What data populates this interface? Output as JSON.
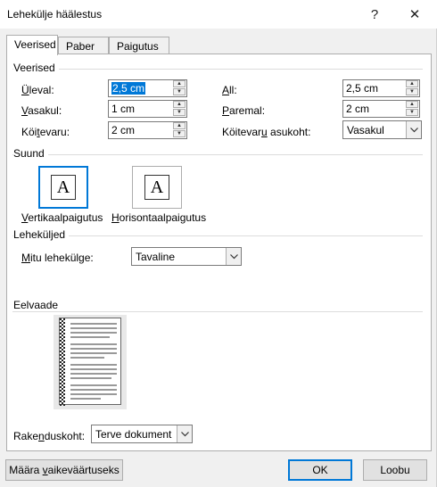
{
  "window": {
    "title": "Lehekülje häälestus",
    "help_glyph": "?",
    "close_glyph": "✕"
  },
  "tabs": [
    {
      "label": "Veerised",
      "active": true
    },
    {
      "label": "Paber",
      "active": false
    },
    {
      "label": "Paigutus",
      "active": false
    }
  ],
  "margins": {
    "group_label": "Veerised",
    "top": {
      "label_u": "Ü",
      "label_rest": "leval:",
      "value": "2,5 cm"
    },
    "bottom": {
      "label_u": "A",
      "label_rest": "ll:",
      "value": "2,5 cm"
    },
    "left": {
      "label_u": "V",
      "label_rest": "asakul:",
      "value": "1 cm"
    },
    "right": {
      "label_u": "P",
      "label_rest": "aremal:",
      "value": "2 cm"
    },
    "gutter": {
      "label_pre": "Köi",
      "label_u": "t",
      "label_rest": "evaru:",
      "value": "2 cm"
    },
    "gutter_position": {
      "label_pre": "Köitevar",
      "label_u": "u",
      "label_rest": " asukoht:",
      "value": "Vasakul"
    }
  },
  "orientation": {
    "group_label": "Suund",
    "portrait": {
      "label_u": "V",
      "label_rest": "ertikaalpaigutus",
      "selected": true
    },
    "landscape": {
      "label_u": "H",
      "label_rest": "orisontaalpaigutus",
      "selected": false
    },
    "icon_letter": "A"
  },
  "pages": {
    "group_label": "Leheküljed",
    "multiple_label_pre": "",
    "multiple_label_u": "M",
    "multiple_label_rest": "itu lehekülge:",
    "multiple_value": "Tavaline"
  },
  "preview": {
    "group_label": "Eelvaade"
  },
  "apply_to": {
    "label_pre": "Rake",
    "label_u": "n",
    "label_rest": "duskoht:",
    "value": "Terve dokument"
  },
  "buttons": {
    "default_pre": "Määra ",
    "default_u": "v",
    "default_rest": "aikeväärtuseks",
    "ok": "OK",
    "cancel": "Loobu"
  },
  "colors": {
    "accent": "#0078d7",
    "dialog_bg": "#f0f0f0",
    "panel_bg": "#ffffff"
  }
}
